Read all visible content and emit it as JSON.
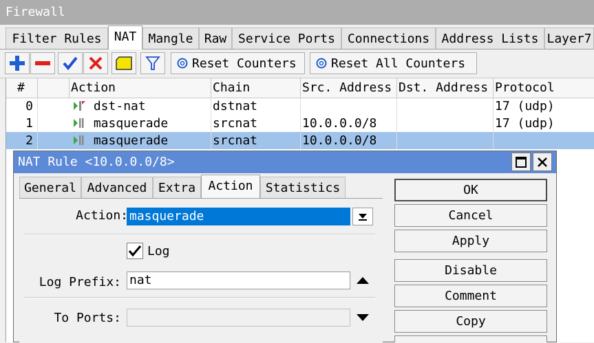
{
  "window": {
    "title": "Firewall"
  },
  "tabs": [
    "Filter Rules",
    "NAT",
    "Mangle",
    "Raw",
    "Service Ports",
    "Connections",
    "Address Lists",
    "Layer7"
  ],
  "toolbar": {
    "reset_counters": "Reset Counters",
    "reset_all_counters": "Reset All Counters",
    "icons": [
      "add-icon",
      "remove-icon",
      "enable-check-icon",
      "disable-x-icon",
      "comment-icon",
      "filter-icon",
      "reset-icon"
    ]
  },
  "table": {
    "columns": [
      "#",
      "",
      "Action",
      "Chain",
      "Src. Address",
      "Dst. Address",
      "Protocol"
    ],
    "rows": [
      {
        "num": "0",
        "action": "dst-nat",
        "chain": "dstnat",
        "src": "",
        "dst": "",
        "protocol": "17 (udp)"
      },
      {
        "num": "1",
        "action": "masquerade",
        "chain": "srcnat",
        "src": "10.0.0.0/8",
        "dst": "",
        "protocol": "17 (udp)"
      },
      {
        "num": "2",
        "action": "masquerade",
        "chain": "srcnat",
        "src": "10.0.0.0/8",
        "dst": "",
        "protocol": ""
      }
    ],
    "selected_row": 2
  },
  "dialog": {
    "title": "NAT Rule <10.0.0.0/8>",
    "tabs": [
      "General",
      "Advanced",
      "Extra",
      "Action",
      "Statistics"
    ],
    "active_tab": "Action",
    "action_label": "Action:",
    "action_value": "masquerade",
    "log_label": "Log",
    "log_checked": true,
    "log_prefix_label": "Log Prefix:",
    "log_prefix_value": "nat",
    "to_ports_label": "To Ports:",
    "to_ports_value": "",
    "buttons": [
      "OK",
      "Cancel",
      "Apply",
      "Disable",
      "Comment",
      "Copy"
    ]
  },
  "colors": {
    "title_bar": "#adadad",
    "dialog_title": "#5d8ad7",
    "selection": "#9fc3ea",
    "field_selected": "#0078d7",
    "add_blue": "#1f5fd1",
    "remove_red": "#e0201a",
    "check_blue": "#1f4fd1"
  }
}
